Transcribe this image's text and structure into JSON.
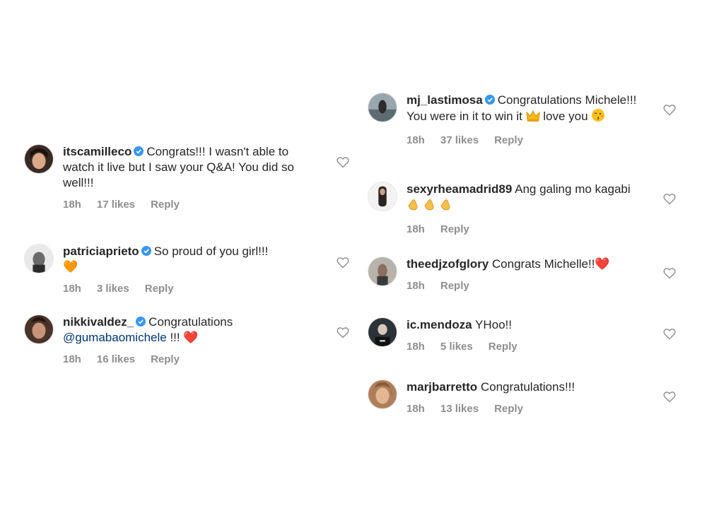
{
  "left_column": [
    {
      "username": "itscamilleco",
      "verified": true,
      "text": "Congrats!!! I wasn't able to watch it live but I saw your Q&A! You did so well!!!",
      "time": "18h",
      "likes": "17 likes",
      "reply": "Reply"
    },
    {
      "username": "patriciaprieto",
      "verified": true,
      "text": "So proud of you girl!!!",
      "emoji": "🧡",
      "time": "18h",
      "likes": "3 likes",
      "reply": "Reply"
    },
    {
      "username": "nikkivaldez_",
      "verified": true,
      "text": "Congratulations",
      "mention": "@gumabaomichele",
      "text_after": " !!! ",
      "emoji": "❤️",
      "time": "18h",
      "likes": "16 likes",
      "reply": "Reply"
    }
  ],
  "right_column": [
    {
      "username": "mj_lastimosa",
      "verified": true,
      "text": "Congratulations Michele!!! You were in it to win it",
      "text_after": " love you",
      "time": "18h",
      "likes": "37 likes",
      "reply": "Reply"
    },
    {
      "username": "sexyrheamadrid89",
      "verified": false,
      "text": "Ang galing mo kagabi",
      "time": "18h",
      "reply": "Reply"
    },
    {
      "username": "theedjzofglory",
      "verified": false,
      "text": "Congrats Michelle!!",
      "emoji": "❤️",
      "time": "18h",
      "reply": "Reply"
    },
    {
      "username": "ic.mendoza",
      "verified": false,
      "text": "YHoo!!",
      "time": "18h",
      "likes": "5 likes",
      "reply": "Reply"
    },
    {
      "username": "marjbarretto",
      "verified": false,
      "text": "Congratulations!!!",
      "time": "18h",
      "likes": "13 likes",
      "reply": "Reply"
    }
  ],
  "colors": {
    "text": "#262626",
    "meta": "#8e8e8e",
    "verified_badge": "#3897f0",
    "mention": "#00376b",
    "heart_emoji": "#e0202a"
  },
  "icons": {
    "like": "heart-outline-icon",
    "verified": "verified-badge-icon"
  }
}
